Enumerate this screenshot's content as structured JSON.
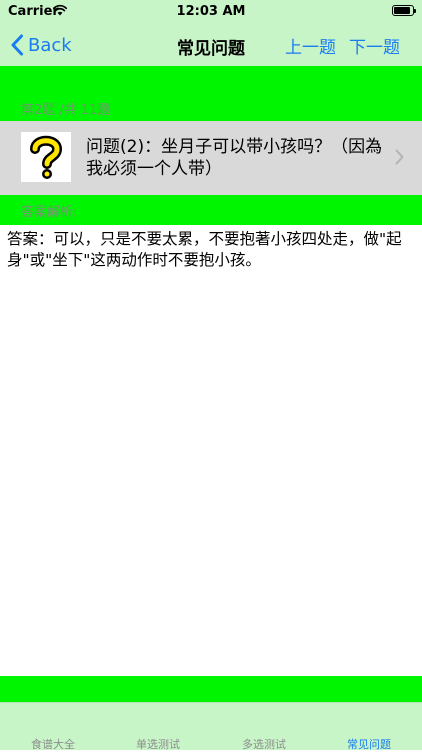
{
  "status_bar": {
    "carrier": "Carrier",
    "time": "12:03 AM"
  },
  "nav": {
    "back_label": "Back",
    "title": "常见问题",
    "prev_label": "上一题",
    "next_label": "下一题"
  },
  "question_count": "第2题 /共 11题",
  "question": {
    "text": "问题(2)：坐月子可以带小孩吗？（因為我必须一个人带）",
    "icon": "question-mark-icon"
  },
  "answer": {
    "header": "答案解析:",
    "text": "答案：可以，只是不要太累，不要抱著小孩四处走，做\"起身\"或\"坐下\"这两动作时不要抱小孩。"
  },
  "tabs": [
    {
      "label": "食谱大全"
    },
    {
      "label": "单选测试"
    },
    {
      "label": "多选测试"
    },
    {
      "label": "常见问题",
      "selected": true
    }
  ],
  "colors": {
    "accent": "#1a7cf0",
    "bar_green": "#00f500",
    "bar_light": "#c8f5c8",
    "muted_label": "#6e9a6e"
  }
}
